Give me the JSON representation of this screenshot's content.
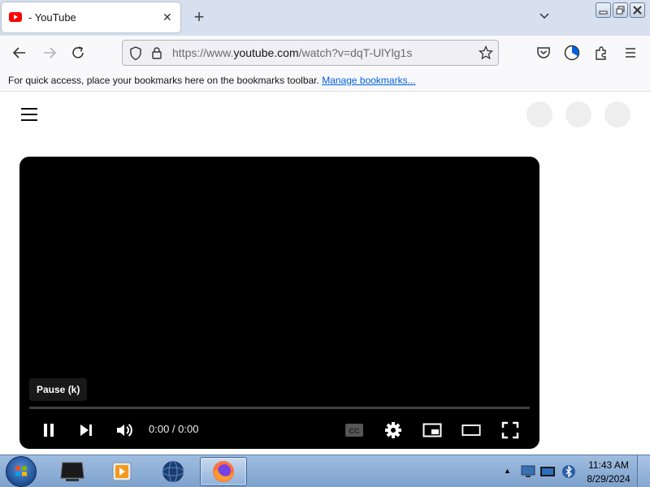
{
  "browser": {
    "tab": {
      "title": "- YouTube",
      "favicon": "youtube-favicon-icon",
      "close_icon": "close-icon"
    },
    "new_tab_icon": "plus-icon",
    "tab_list_icon": "chevron-down-icon",
    "window_controls": [
      "minimize-icon",
      "restore-icon",
      "close-icon"
    ],
    "nav_icons": [
      "back-arrow-icon",
      "forward-arrow-icon",
      "reload-icon"
    ],
    "url": {
      "prefix": "https://www.",
      "domain": "youtube.com",
      "path": "/watch?v=dqT-UlYlg1s",
      "icons": [
        "shield-icon",
        "lock-icon",
        "star-icon"
      ]
    },
    "toolbar_icons": [
      "pocket-icon",
      "account-icon",
      "extensions-icon",
      "menu-icon"
    ],
    "bookmarks": {
      "message": "For quick access, place your bookmarks here on the bookmarks toolbar.",
      "link": "Manage bookmarks..."
    }
  },
  "youtube": {
    "menu_icon": "hamburger-icon",
    "header_placeholders": 3,
    "player": {
      "tooltip": "Pause (k)",
      "time": "0:00 / 0:00",
      "progress_fraction": 0,
      "controls": [
        "pause-icon",
        "next-icon",
        "volume-icon",
        "captions-icon",
        "settings-icon",
        "miniplayer-icon",
        "theater-mode-icon",
        "fullscreen-icon"
      ],
      "captions_label": "CC"
    }
  },
  "taskbar": {
    "start_icon": "windows-start-icon",
    "apps": [
      "monitor-app-icon",
      "media-player-icon",
      "globe-app-icon",
      "firefox-icon"
    ],
    "active_app": "firefox-icon",
    "tray_icons": [
      "tray-arrow-icon",
      "display-icon",
      "network-icon",
      "bluetooth-icon"
    ],
    "time": "11:43 AM",
    "date": "8/29/2024"
  },
  "colors": {
    "tabstrip_bg": "#d6e0ef",
    "youtube_red": "#ff0000",
    "link_blue": "#0060df",
    "player_bg": "#000000",
    "taskbar_bg": "#8fb0d8"
  }
}
